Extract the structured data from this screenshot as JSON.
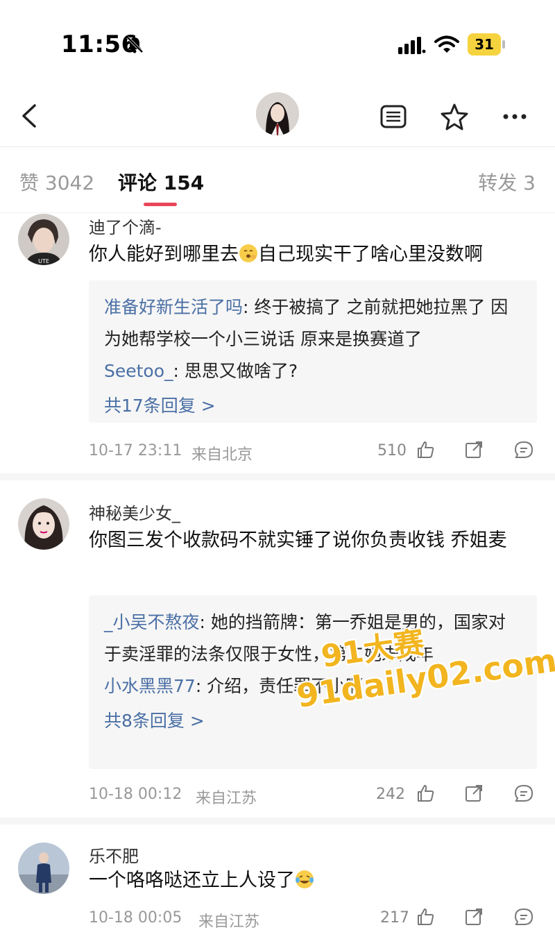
{
  "status_bar": {
    "time": "11:56",
    "battery": "31"
  },
  "nav": {
    "back_icon": "chevron-left-icon",
    "avatar": "profile-avatar",
    "icons": [
      "list-icon",
      "star-icon",
      "more-icon"
    ]
  },
  "tabs": {
    "likes": "赞 3042",
    "comments": "评论 154",
    "reposts": "转发 3",
    "active_color": "#e8455a"
  },
  "comments": [
    {
      "username": "迪了个滴-",
      "content_before_emoji": "你人能好到哪里去",
      "emoji": "yawning-face-emoji",
      "content_after_emoji": "自己现实干了啥心里没数啊",
      "replies": [
        {
          "user": "准备好新生活了吗",
          "text": ": 终于被搞了 之前就把她拉黑了 因为她帮学校一个小三说话 原来是换赛道了"
        },
        {
          "user": "Seetoo_",
          "text": ": 思思又做啥了?"
        }
      ],
      "more_replies": "共17条回复 >",
      "time": "10-17 23:11",
      "location": "来自北京",
      "likes": "510"
    },
    {
      "username": "神秘美少女_",
      "content": "你图三发个收款码不就实锤了说你负责收钱 乔姐麦",
      "replies": [
        {
          "user": "_小吴不熬夜",
          "text": ": 她的挡箭牌：第一乔姐是男的，国家对于卖淫罪的法条仅限于女性，第二她未成年"
        },
        {
          "user": "小水黑黑77",
          "text": ": 介绍，责任罪不小啊"
        }
      ],
      "more_replies": "共8条回复 >",
      "time": "10-18 00:12",
      "location": "来自江苏",
      "likes": "242"
    },
    {
      "username": "乐不肥",
      "content_before_emoji": "一个咯咯哒还立上人设了",
      "emoji": "laughing-crying-emoji",
      "time": "10-18 00:05",
      "location": "来自江苏",
      "likes": "217"
    }
  ],
  "watermark": {
    "line1": "91大赛",
    "line2": "91daily02.com"
  },
  "meta_icons": [
    "thumbs-up-icon",
    "share-icon",
    "comment-icon"
  ]
}
